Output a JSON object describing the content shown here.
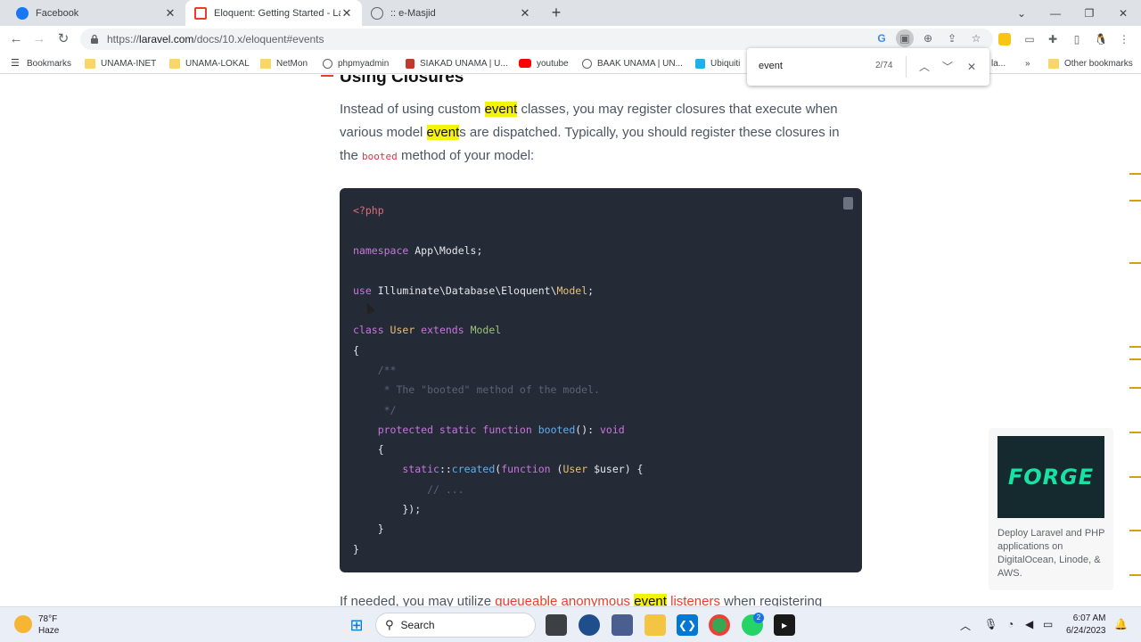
{
  "tabs": [
    {
      "title": "Facebook",
      "icon": "facebook-icon",
      "active": false
    },
    {
      "title": "Eloquent: Getting Started - Laravel",
      "icon": "laravel-icon",
      "active": true
    },
    {
      "title": ":: e-Masjid",
      "icon": "globe-icon",
      "active": false
    }
  ],
  "toolbar": {
    "url_prefix": "https://",
    "url_host": "laravel.com",
    "url_path": "/docs/10.x/eloquent#events"
  },
  "bookmarks": [
    {
      "label": "Bookmarks",
      "icon": "star-list-icon"
    },
    {
      "label": "UNAMA-INET",
      "icon": "folder-icon"
    },
    {
      "label": "UNAMA-LOKAL",
      "icon": "folder-icon"
    },
    {
      "label": "NetMon",
      "icon": "folder-icon"
    },
    {
      "label": "phpmyadmin",
      "icon": "globe-icon"
    },
    {
      "label": "SIAKAD UNAMA | U...",
      "icon": "unama-icon"
    },
    {
      "label": "youtube",
      "icon": "youtube-icon"
    },
    {
      "label": "BAAK UNAMA | UN...",
      "icon": "globe-icon"
    },
    {
      "label": "Ubiquiti",
      "icon": "ubiquiti-icon"
    },
    {
      "label": "la...",
      "icon": "folder-icon"
    },
    {
      "label": "Other bookmarks",
      "icon": "folder-icon"
    }
  ],
  "find": {
    "term": "event",
    "count": "2/74"
  },
  "doc": {
    "heading": "Using Closures",
    "p1_a": "Instead of using custom ",
    "p1_hl1": "event",
    "p1_b": " classes, you may register closures that execute when various model ",
    "p1_hl2": "event",
    "p1_c": "s are dispatched. Typically, you should register these closures in the ",
    "p1_code": "booted",
    "p1_d": " method of your model:",
    "p2_a": "If needed, you may utilize ",
    "p2_link": "queueable anonymous ",
    "p2_hl": "event",
    "p2_link2": " listeners",
    "p2_b": " when registering"
  },
  "code": {
    "l1": "<?php",
    "l2_k": "namespace",
    "l2_t": " App\\Models;",
    "l3_k": "use",
    "l3_t": " Illuminate\\Database\\Eloquent\\",
    "l3_c": "Model",
    "l3_e": ";",
    "l4_k1": "class",
    "l4_c1": " User",
    "l4_k2": " extends",
    "l4_c2": " Model",
    "l5": "{",
    "l6": "    /**",
    "l7": "     * The \"booted\" method of the model.",
    "l8": "     */",
    "l9_k": "    protected static function",
    "l9_f": " booted",
    "l9_t": "():",
    "l9_r": " void",
    "l10": "    {",
    "l11_k": "        static",
    "l11_t": "::",
    "l11_f": "created",
    "l11_t2": "(",
    "l11_k2": "function",
    "l11_t3": " (",
    "l11_c": "User",
    "l11_v": " $user",
    "l11_t4": ") {",
    "l12": "            // ...",
    "l13": "        });",
    "l14": "    }",
    "l15": "}"
  },
  "ad": {
    "logo": "FORGE",
    "text": "Deploy Laravel and PHP applications on DigitalOcean, Linode, & AWS."
  },
  "taskbar": {
    "temp": "78°F",
    "weather": "Haze",
    "search": "Search",
    "time": "6:07 AM",
    "date": "6/24/2023",
    "whatsapp_badge": "2"
  }
}
